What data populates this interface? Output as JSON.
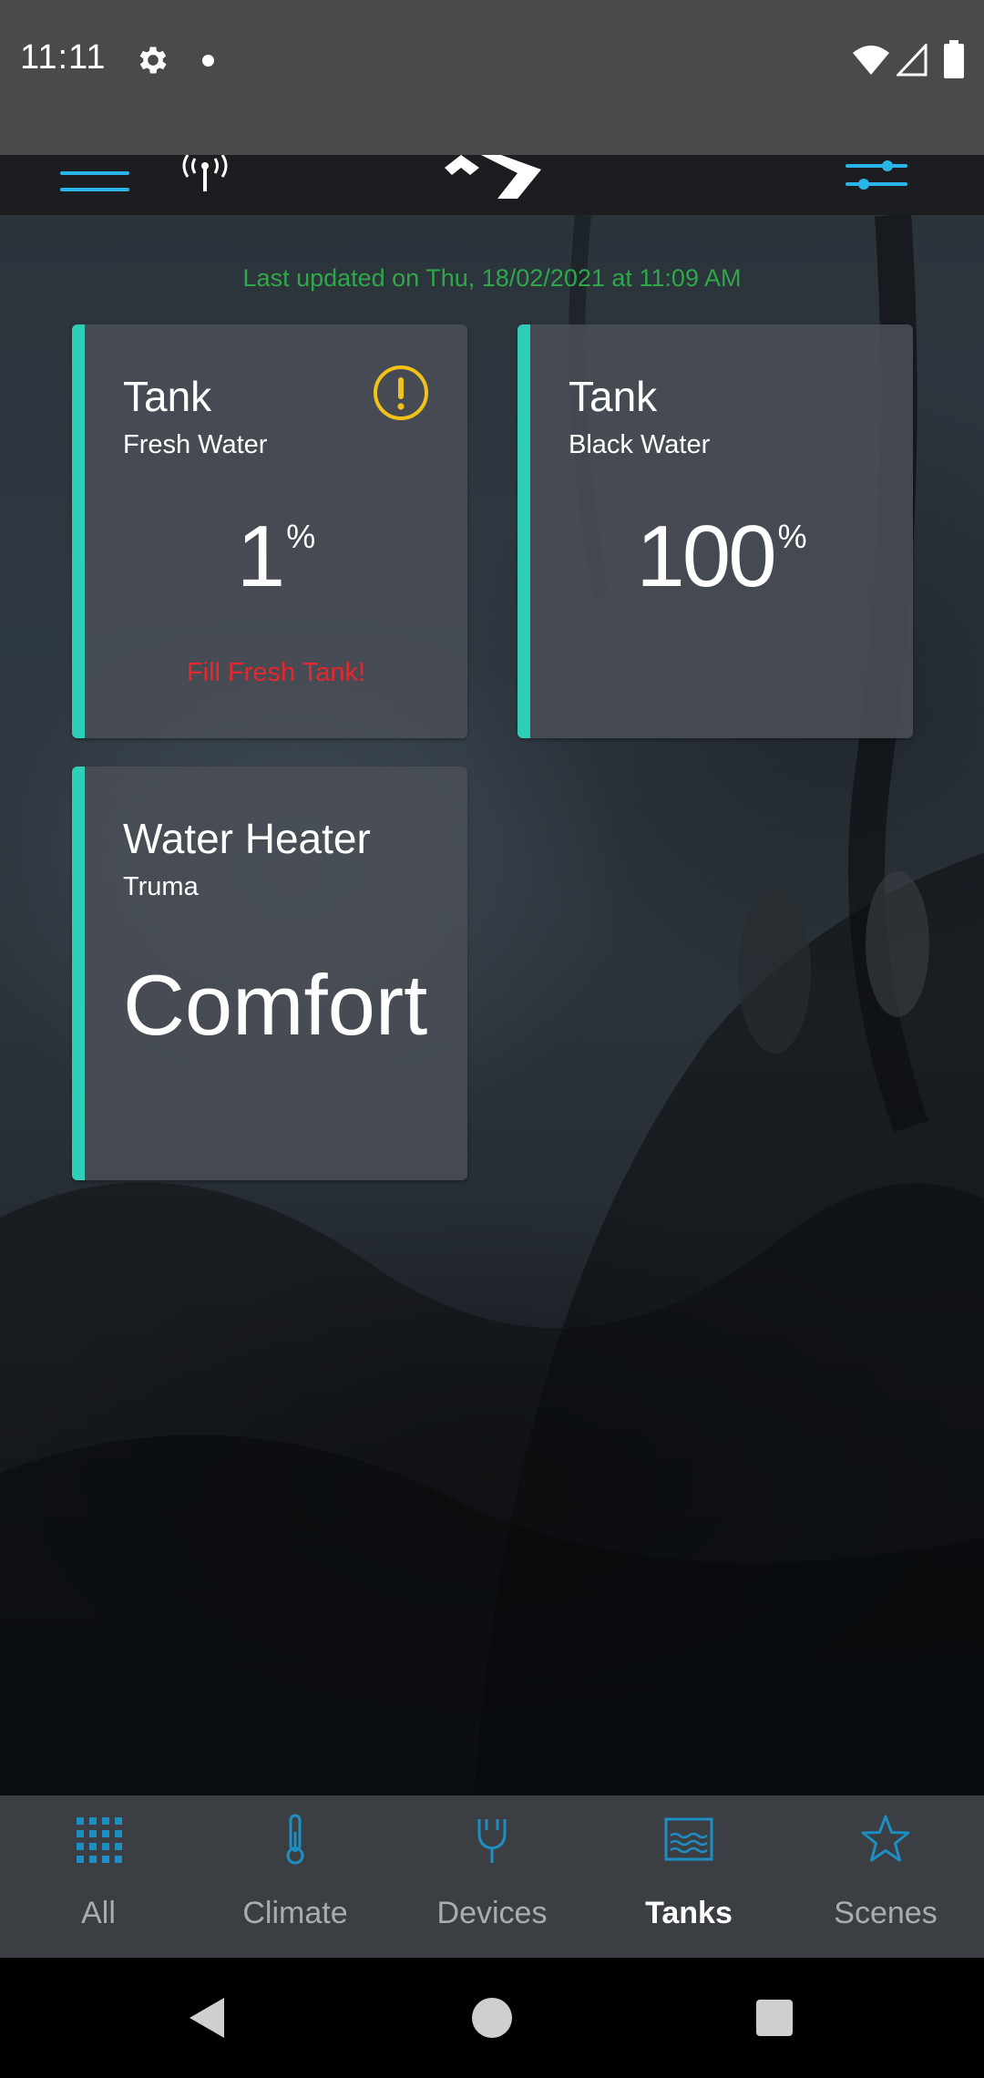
{
  "status_bar": {
    "time": "11:11"
  },
  "header": {
    "last_updated": "Last updated on Thu, 18/02/2021 at 11:09 AM"
  },
  "cards": [
    {
      "title": "Tank",
      "subtitle": "Fresh Water",
      "value": "1",
      "unit": "%",
      "alert": "Fill Fresh Tank!",
      "warning_icon": "warning-icon"
    },
    {
      "title": "Tank",
      "subtitle": "Black Water",
      "value": "100",
      "unit": "%"
    },
    {
      "title": "Water Heater",
      "subtitle": "Truma",
      "value": "Comfort"
    }
  ],
  "nav": {
    "items": [
      {
        "label": "All",
        "icon": "grid-icon"
      },
      {
        "label": "Climate",
        "icon": "thermometer-icon"
      },
      {
        "label": "Devices",
        "icon": "plug-icon"
      },
      {
        "label": "Tanks",
        "icon": "tank-icon",
        "active": true
      },
      {
        "label": "Scenes",
        "icon": "star-icon"
      }
    ]
  },
  "colors": {
    "accent": "#2ecfb6",
    "updated_text": "#2fa84a",
    "alert_text": "#e8262e",
    "warning": "#f2c21b",
    "nav_icon": "#1e8fc3"
  }
}
